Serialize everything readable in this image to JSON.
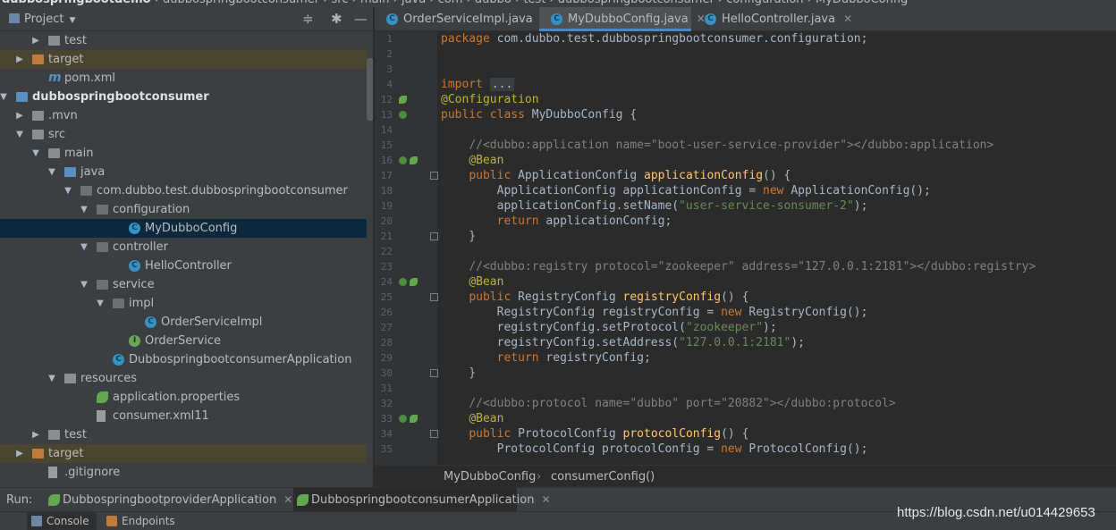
{
  "top_breadcrumb": [
    "dubbospringbootdemo",
    "dubbospringbootconsumer",
    "src",
    "main",
    "java",
    "com",
    "dubbo",
    "test",
    "dubbospringbootconsumer",
    "configuration",
    "MyDubboConfig"
  ],
  "project_panel": {
    "title": "Project",
    "tree": [
      {
        "label": "test",
        "icon": "folder-icon",
        "arrow": "right",
        "level": 3
      },
      {
        "label": "target",
        "icon": "folder-orange-icon",
        "arrow": "right",
        "level": 2
      },
      {
        "label": "pom.xml",
        "icon": "maven-icon",
        "arrow": "",
        "level": 3
      },
      {
        "label": "dubbospringbootconsumer",
        "icon": "module-folder-icon",
        "arrow": "down",
        "level": 1
      },
      {
        "label": ".mvn",
        "icon": "folder-icon",
        "arrow": "right",
        "level": 2
      },
      {
        "label": "src",
        "icon": "folder-icon",
        "arrow": "down",
        "level": 2
      },
      {
        "label": "main",
        "icon": "folder-icon",
        "arrow": "down",
        "level": 3
      },
      {
        "label": "java",
        "icon": "source-folder-icon",
        "arrow": "down",
        "level": 4
      },
      {
        "label": "com.dubbo.test.dubbospringbootconsumer",
        "icon": "package-icon",
        "arrow": "down",
        "level": 5
      },
      {
        "label": "configuration",
        "icon": "package-icon",
        "arrow": "down",
        "level": 6
      },
      {
        "label": "MyDubboConfig",
        "icon": "class-icon",
        "arrow": "",
        "level": 8
      },
      {
        "label": "controller",
        "icon": "package-icon",
        "arrow": "down",
        "level": 6
      },
      {
        "label": "HelloController",
        "icon": "class-icon",
        "arrow": "",
        "level": 8
      },
      {
        "label": "service",
        "icon": "package-icon",
        "arrow": "down",
        "level": 6
      },
      {
        "label": "impl",
        "icon": "package-icon",
        "arrow": "down",
        "level": 7
      },
      {
        "label": "OrderServiceImpl",
        "icon": "class-icon",
        "arrow": "",
        "level": 9
      },
      {
        "label": "OrderService",
        "icon": "interface-icon",
        "arrow": "",
        "level": 8
      },
      {
        "label": "DubbospringbootconsumerApplication",
        "icon": "spring-class-icon",
        "arrow": "",
        "level": 7
      },
      {
        "label": "resources",
        "icon": "resources-folder-icon",
        "arrow": "down",
        "level": 4
      },
      {
        "label": "application.properties",
        "icon": "spring-leaf-icon",
        "arrow": "",
        "level": 6
      },
      {
        "label": "consumer.xml11",
        "icon": "file-icon",
        "arrow": "",
        "level": 6
      },
      {
        "label": "test",
        "icon": "folder-icon",
        "arrow": "right",
        "level": 3
      },
      {
        "label": "target",
        "icon": "folder-orange-icon",
        "arrow": "right",
        "level": 2
      },
      {
        "label": ".gitignore",
        "icon": "file-icon",
        "arrow": "",
        "level": 3
      }
    ]
  },
  "editor_tabs": [
    {
      "label": "OrderServiceImpl.java",
      "active": false
    },
    {
      "label": "MyDubboConfig.java",
      "active": true
    },
    {
      "label": "HelloController.java",
      "active": false
    }
  ],
  "code_lines": [
    {
      "n": "1",
      "html": "<span class='kw'>package</span> com.dubbo.test.dubbospringbootconsumer.configuration;"
    },
    {
      "n": "2",
      "html": ""
    },
    {
      "n": "3",
      "html": ""
    },
    {
      "n": "4",
      "html": "<span class='kw'>import</span> <span class='fold-box'>...</span>"
    },
    {
      "n": "12",
      "html": "<span class='an'>@Configuration</span>"
    },
    {
      "n": "13",
      "html": "<span class='kw'>public class</span> MyDubboConfig {"
    },
    {
      "n": "14",
      "html": ""
    },
    {
      "n": "15",
      "html": "    <span class='cm'>//&lt;dubbo:application name=\"boot-user-service-provider\"&gt;&lt;/dubbo:application&gt;</span>"
    },
    {
      "n": "16",
      "html": "    <span class='an'>@Bean</span>"
    },
    {
      "n": "17",
      "html": "    <span class='kw'>public</span> ApplicationConfig <span class='fn'>applicationConfig</span>() {"
    },
    {
      "n": "18",
      "html": "        ApplicationConfig applicationConfig = <span class='kw'>new</span> ApplicationConfig();"
    },
    {
      "n": "19",
      "html": "        applicationConfig.setName(<span class='st'>\"user-service-sonsumer-2\"</span>);"
    },
    {
      "n": "20",
      "html": "        <span class='kw'>return</span> applicationConfig;"
    },
    {
      "n": "21",
      "html": "    }"
    },
    {
      "n": "22",
      "html": ""
    },
    {
      "n": "23",
      "html": "    <span class='cm'>//&lt;dubbo:registry protocol=\"zookeeper\" address=\"127.0.0.1:2181\"&gt;&lt;/dubbo:registry&gt;</span>"
    },
    {
      "n": "24",
      "html": "    <span class='an'>@Bean</span>"
    },
    {
      "n": "25",
      "html": "    <span class='kw'>public</span> RegistryConfig <span class='fn'>registryConfig</span>() {"
    },
    {
      "n": "26",
      "html": "        RegistryConfig registryConfig = <span class='kw'>new</span> RegistryConfig();"
    },
    {
      "n": "27",
      "html": "        registryConfig.setProtocol(<span class='st'>\"zookeeper\"</span>);"
    },
    {
      "n": "28",
      "html": "        registryConfig.setAddress(<span class='st'>\"127.0.0.1:2181\"</span>);"
    },
    {
      "n": "29",
      "html": "        <span class='kw'>return</span> registryConfig;"
    },
    {
      "n": "30",
      "html": "    }"
    },
    {
      "n": "31",
      "html": ""
    },
    {
      "n": "32",
      "html": "    <span class='cm'>//&lt;dubbo:protocol name=\"dubbo\" port=\"20882\"&gt;&lt;/dubbo:protocol&gt;</span>"
    },
    {
      "n": "33",
      "html": "    <span class='an'>@Bean</span>"
    },
    {
      "n": "34",
      "html": "    <span class='kw'>public</span> ProtocolConfig <span class='fn'>protocolConfig</span>() {"
    },
    {
      "n": "35",
      "html": "        ProtocolConfig protocolConfig = <span class='kw'>new</span> ProtocolConfig();"
    }
  ],
  "editor_breadcrumb": {
    "class": "MyDubboConfig",
    "separator": "›",
    "method": "consumerConfig()"
  },
  "run_bar": {
    "label": "Run:",
    "tabs": [
      {
        "label": "DubbospringbootproviderApplication",
        "active": false
      },
      {
        "label": "DubbospringbootconsumerApplication",
        "active": true
      }
    ]
  },
  "bottom_tabs": [
    {
      "label": "Console",
      "active": true
    },
    {
      "label": "Endpoints",
      "active": false
    }
  ],
  "watermark": "https://blog.csdn.net/u014429653"
}
